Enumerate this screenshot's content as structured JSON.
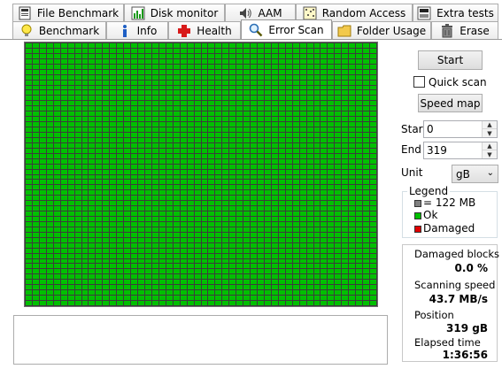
{
  "tabs": {
    "row1": [
      {
        "label": "File Benchmark",
        "icon": "file-benchmark-icon"
      },
      {
        "label": "Disk monitor",
        "icon": "disk-monitor-icon"
      },
      {
        "label": "AAM",
        "icon": "speaker-icon"
      },
      {
        "label": "Random Access",
        "icon": "random-access-icon"
      },
      {
        "label": "Extra tests",
        "icon": "extra-tests-icon"
      }
    ],
    "row2": [
      {
        "label": "Benchmark",
        "icon": "lightbulb-icon"
      },
      {
        "label": "Info",
        "icon": "info-icon"
      },
      {
        "label": "Health",
        "icon": "health-cross-icon"
      },
      {
        "label": "Error Scan",
        "icon": "magnifier-icon",
        "active": true
      },
      {
        "label": "Folder Usage",
        "icon": "folder-icon"
      },
      {
        "label": "Erase",
        "icon": "trash-icon"
      }
    ]
  },
  "controls": {
    "start_button": "Start",
    "quick_scan_label": "Quick scan",
    "quick_scan_checked": false,
    "speed_map_button": "Speed map",
    "start_label": "Start",
    "start_value": "0",
    "end_label": "End",
    "end_value": "319",
    "unit_label": "Unit",
    "unit_value": "gB"
  },
  "legend": {
    "title": "Legend",
    "block_size": "= 122 MB",
    "ok": "Ok",
    "damaged": "Damaged",
    "colors": {
      "block": "#808080",
      "ok": "#00c000",
      "damaged": "#e00000"
    }
  },
  "stats": {
    "damaged_blocks_label": "Damaged blocks",
    "damaged_blocks_value": "0.0 %",
    "scanning_speed_label": "Scanning speed",
    "scanning_speed_value": "43.7 MB/s",
    "position_label": "Position",
    "position_value": "319 gB",
    "elapsed_time_label": "Elapsed time",
    "elapsed_time_value": "1:36:56"
  },
  "scan_map": {
    "status": "ok",
    "block_color": "#00c000",
    "damaged_count": 0
  }
}
